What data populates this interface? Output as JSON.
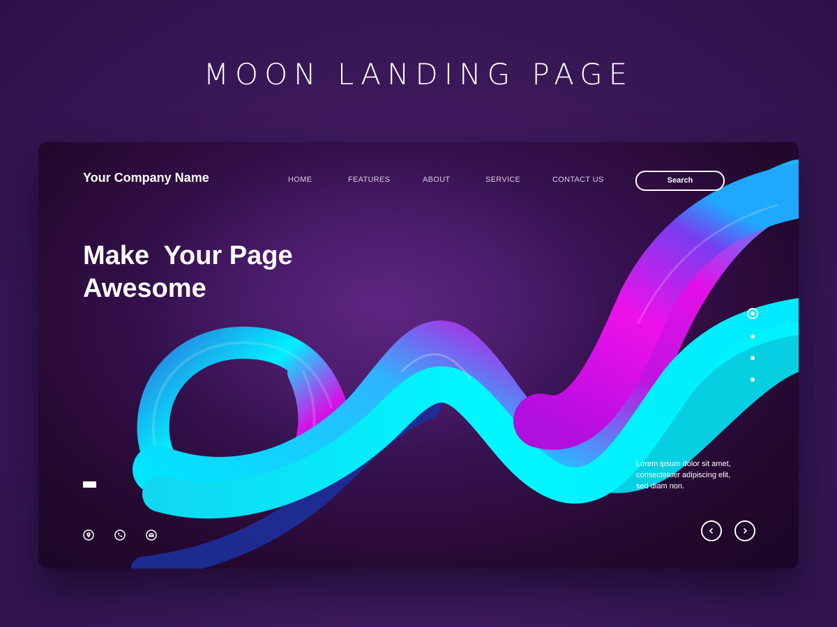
{
  "page": {
    "heading": "MOON LANDING PAGE"
  },
  "header": {
    "company_name": "Your Company Name",
    "nav": [
      {
        "label": "HOME"
      },
      {
        "label": "FEATURES"
      },
      {
        "label": "ABOUT"
      },
      {
        "label": "SERVICE"
      },
      {
        "label": "CONTACT US"
      }
    ],
    "search_label": "Search"
  },
  "hero": {
    "title_line1": "Make  Your Page",
    "title_line2": "Awesome",
    "description": [
      "Lorem ipsum dolor sit amet,",
      "consectetuer adipiscing elit,",
      "sed diam non."
    ]
  },
  "slider": {
    "dot_count": 4,
    "active_dot": 1
  },
  "contact_icons": [
    "location-pin-icon",
    "phone-icon",
    "mail-icon"
  ],
  "arrows": {
    "prev_icon": "chevron-left-icon",
    "next_icon": "chevron-right-icon"
  },
  "colors": {
    "background": "#3d1a5e",
    "card": "#24082f",
    "ribbon_cyan": "#00f0ff",
    "ribbon_magenta": "#e60ee6",
    "ribbon_blue": "#3a4fc8",
    "text": "#ffffff"
  }
}
